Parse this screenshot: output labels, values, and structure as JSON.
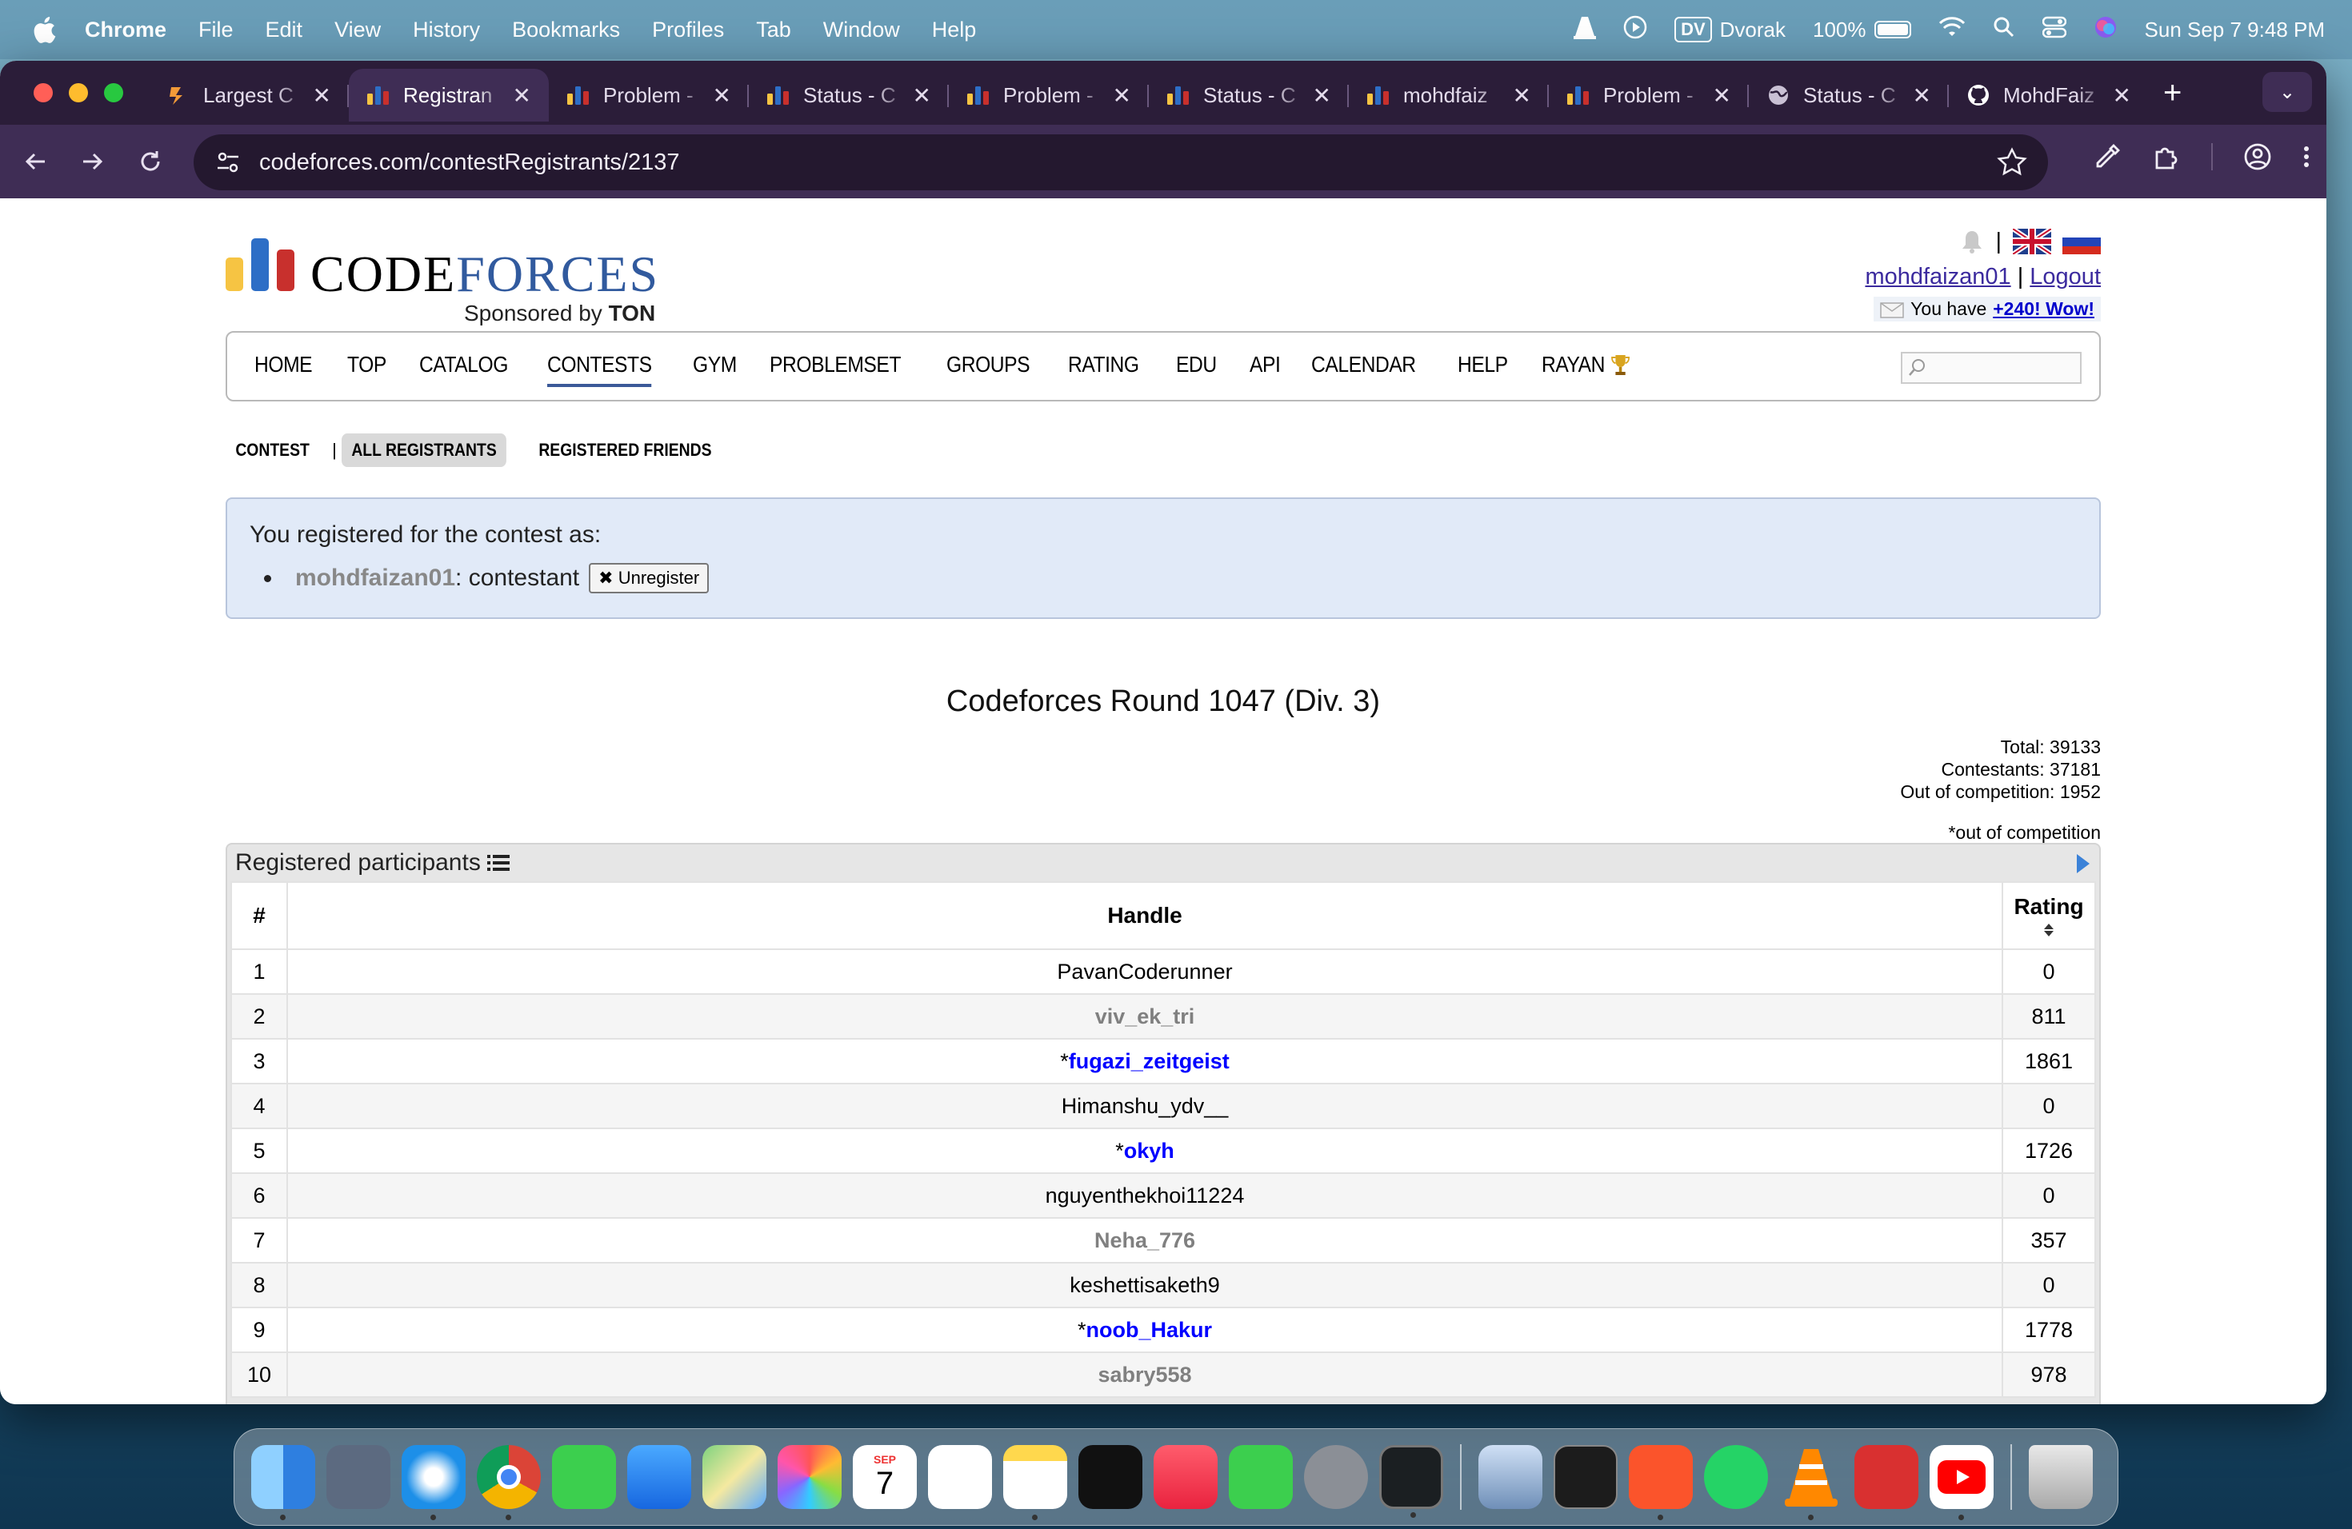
{
  "menubar": {
    "app": "Chrome",
    "items": [
      "File",
      "Edit",
      "View",
      "History",
      "Bookmarks",
      "Profiles",
      "Tab",
      "Window",
      "Help"
    ],
    "keyboard_badge": "DV",
    "keyboard_layout": "Dvorak",
    "battery": "100%",
    "datetime": "Sun Sep 7  9:48 PM"
  },
  "tabs": [
    {
      "title": "Largest C",
      "icon": "tab-loading-icon"
    },
    {
      "title": "Registran",
      "icon": "codeforces-favicon",
      "active": true
    },
    {
      "title": "Problem -",
      "icon": "codeforces-favicon"
    },
    {
      "title": "Status - C",
      "icon": "codeforces-favicon"
    },
    {
      "title": "Problem -",
      "icon": "codeforces-favicon"
    },
    {
      "title": "Status - C",
      "icon": "codeforces-favicon"
    },
    {
      "title": "mohdfaiz",
      "icon": "codeforces-favicon"
    },
    {
      "title": "Problem -",
      "icon": "codeforces-favicon"
    },
    {
      "title": "Status - C",
      "icon": "globe-icon"
    },
    {
      "title": "MohdFaiz",
      "icon": "github-icon"
    }
  ],
  "address_bar": {
    "url": "codeforces.com/contestRegistrants/2137"
  },
  "site": {
    "logo_code": "CODE",
    "logo_forces": "FORCES",
    "logo_sponsor_prefix": "Sponsored by",
    "logo_sponsor": "TON",
    "username": "mohdfaizan01",
    "separator": "|",
    "logout": "Logout",
    "message_prefix": "You have",
    "message_link": "+240! Wow!"
  },
  "main_menu": [
    "HOME",
    "TOP",
    "CATALOG",
    "CONTESTS",
    "GYM",
    "PROBLEMSET",
    "GROUPS",
    "RATING",
    "EDU",
    "API",
    "CALENDAR",
    "HELP",
    "RAYAN"
  ],
  "main_menu_active": "CONTESTS",
  "second_nav": {
    "contest": "CONTEST",
    "sep": "|",
    "all": "ALL REGISTRANTS",
    "friends": "REGISTERED FRIENDS"
  },
  "registration": {
    "heading": "You registered for the contest as:",
    "handle": "mohdfaizan01",
    "role": ": contestant",
    "button": "Unregister"
  },
  "contest": {
    "title": "Codeforces Round 1047 (Div. 3)",
    "total": "Total: 39133",
    "contestants": "Contestants: 37181",
    "out_of_competition": "Out of competition: 1952",
    "note": "*out of competition"
  },
  "table": {
    "caption": "Registered participants",
    "headers": {
      "num": "#",
      "handle": "Handle",
      "rating": "Rating"
    },
    "rows": [
      {
        "num": "1",
        "handle": "PavanCoderunner",
        "rating": "0",
        "color": "black",
        "star": ""
      },
      {
        "num": "2",
        "handle": "viv_ek_tri",
        "rating": "811",
        "color": "gray",
        "star": ""
      },
      {
        "num": "3",
        "handle": "fugazi_zeitgeist",
        "rating": "1861",
        "color": "blue",
        "star": "*"
      },
      {
        "num": "4",
        "handle": "Himanshu_ydv__",
        "rating": "0",
        "color": "black",
        "star": ""
      },
      {
        "num": "5",
        "handle": "okyh",
        "rating": "1726",
        "color": "blue",
        "star": "*"
      },
      {
        "num": "6",
        "handle": "nguyenthekhoi11224",
        "rating": "0",
        "color": "black",
        "star": ""
      },
      {
        "num": "7",
        "handle": "Neha_776",
        "rating": "357",
        "color": "gray",
        "star": ""
      },
      {
        "num": "8",
        "handle": "keshettisaketh9",
        "rating": "0",
        "color": "black",
        "star": ""
      },
      {
        "num": "9",
        "handle": "noob_Hakur",
        "rating": "1778",
        "color": "blue",
        "star": "*"
      },
      {
        "num": "10",
        "handle": "sabry558",
        "rating": "978",
        "color": "gray",
        "star": ""
      }
    ]
  },
  "dock": {
    "calendar_month": "SEP",
    "calendar_day": "7",
    "apps": [
      "Finder",
      "Launchpad",
      "Safari",
      "Chrome",
      "Messages",
      "Mail",
      "Maps",
      "Photos",
      "Calendar",
      "Reminders",
      "Notes",
      "TV",
      "Music",
      "FaceTime",
      "System Settings",
      "Activity Monitor",
      "Preview",
      "Terminal",
      "Brave",
      "WhatsApp",
      "VLC",
      "Photo Booth",
      "YouTube",
      "Trash"
    ]
  },
  "colors": {
    "tabstrip": "#2b1d39",
    "toolbar": "#3f2d55",
    "reg_box": "#e1eaf8",
    "handle_blue": "#0000ff",
    "handle_gray": "#808080",
    "logo_blue": "#315a9e"
  }
}
